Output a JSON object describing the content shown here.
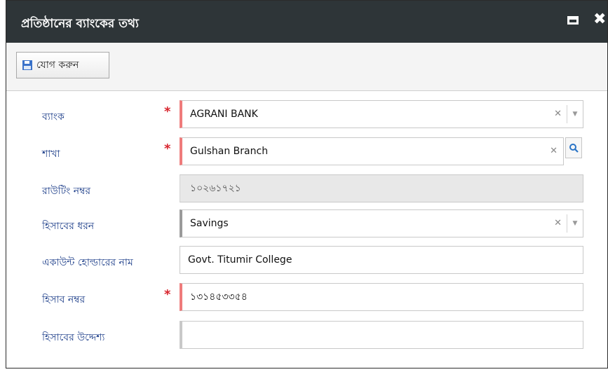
{
  "window": {
    "title": "প্রতিষ্ঠানের ব্যাংকের তথ্য"
  },
  "toolbar": {
    "add_label": "যোগ করুন"
  },
  "form": {
    "bank": {
      "label": "ব্যাংক",
      "value": "AGRANI BANK",
      "required": true
    },
    "branch": {
      "label": "শাখা",
      "value": "Gulshan Branch",
      "required": true
    },
    "routing": {
      "label": "রাউটিং নম্বর",
      "value": "১০২৬১৭২১"
    },
    "account_type": {
      "label": "হিসাবের ধরন",
      "value": "Savings"
    },
    "holder": {
      "label": "একাউন্ট হোল্ডারের নাম",
      "value": "Govt. Titumir College"
    },
    "account_no": {
      "label": "হিসাব নম্বর",
      "value": "১৩১৪৫৩৩৫৪",
      "required": true
    },
    "purpose": {
      "label": "হিসাবের উদ্দেশ্য",
      "value": ""
    }
  },
  "colors": {
    "titlebar": "#2e3538",
    "label": "#1e3f8a",
    "required_star": "#d8242d",
    "required_border": "#ef7b7b"
  }
}
